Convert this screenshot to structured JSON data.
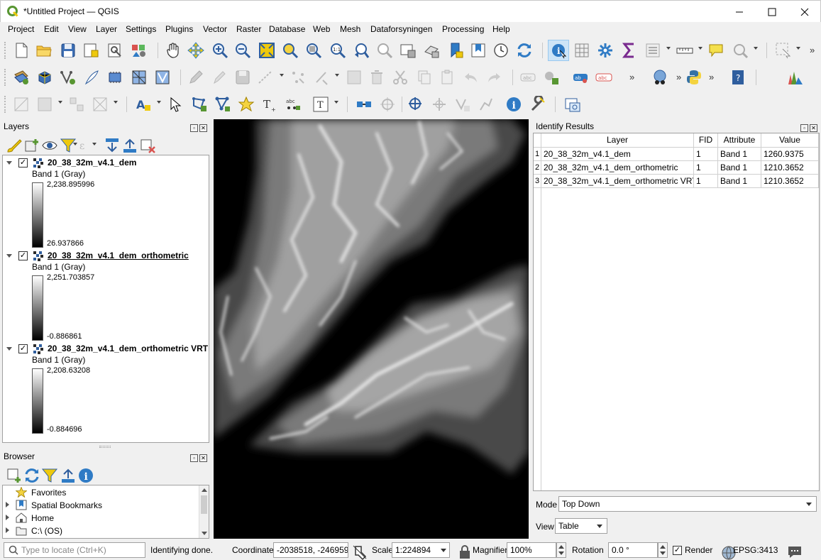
{
  "window": {
    "title": "*Untitled Project — QGIS",
    "minimize_icon": "minimize-icon",
    "maximize_icon": "maximize-icon",
    "close_icon": "close-icon"
  },
  "menu": [
    "Project",
    "Edit",
    "View",
    "Layer",
    "Settings",
    "Plugins",
    "Vector",
    "Raster",
    "Database",
    "Web",
    "Mesh",
    "Dataforsyningen",
    "Processing",
    "Help"
  ],
  "layers_panel": {
    "title": "Layers",
    "layers": [
      {
        "name": "20_38_32m_v4.1_dem",
        "band": "Band 1 (Gray)",
        "max": "2,238.895996",
        "min": "26.937866",
        "checked": true
      },
      {
        "name": "20_38_32m_v4.1_dem_orthometric",
        "band": "Band 1 (Gray)",
        "max": "2,251.703857",
        "min": "-0.886861",
        "checked": true
      },
      {
        "name": "20_38_32m_v4.1_dem_orthometric VRT",
        "band": "Band 1 (Gray)",
        "max": "2,208.63208",
        "min": "-0.884696",
        "checked": true
      }
    ]
  },
  "browser_panel": {
    "title": "Browser",
    "items": [
      "Favorites",
      "Spatial Bookmarks",
      "Home",
      "C:\\ (OS)"
    ]
  },
  "identify_panel": {
    "title": "Identify Results",
    "columns": [
      "Layer",
      "FID",
      "Attribute",
      "Value"
    ],
    "rows": [
      {
        "num": "1",
        "layer": "20_38_32m_v4.1_dem",
        "fid": "1",
        "attribute": "Band 1",
        "value": "1260.9375"
      },
      {
        "num": "2",
        "layer": "20_38_32m_v4.1_dem_orthometric",
        "fid": "1",
        "attribute": "Band 1",
        "value": "1210.3652"
      },
      {
        "num": "3",
        "layer": "20_38_32m_v4.1_dem_orthometric VRT",
        "fid": "1",
        "attribute": "Band 1",
        "value": "1210.3652"
      }
    ],
    "mode_label": "Mode",
    "mode_value": "Top Down",
    "view_label": "View",
    "view_value": "Table"
  },
  "statusbar": {
    "locator_placeholder": "Type to locate (Ctrl+K)",
    "message": "Identifying done.",
    "coordinate_label": "Coordinate",
    "coordinate_value": "-2038518, -246959",
    "scale_label": "Scale",
    "scale_value": "1:224894",
    "magnifier_label": "Magnifier",
    "magnifier_value": "100%",
    "rotation_label": "Rotation",
    "rotation_value": "0.0 °",
    "render_label": "Render",
    "render_checked": true,
    "crs": "EPSG:3413"
  },
  "colors": {
    "qgis_green": "#589632",
    "qgis_yellow": "#eec90d",
    "accent_blue": "#2f7bc5",
    "selected_tool": "#cce4f7"
  }
}
